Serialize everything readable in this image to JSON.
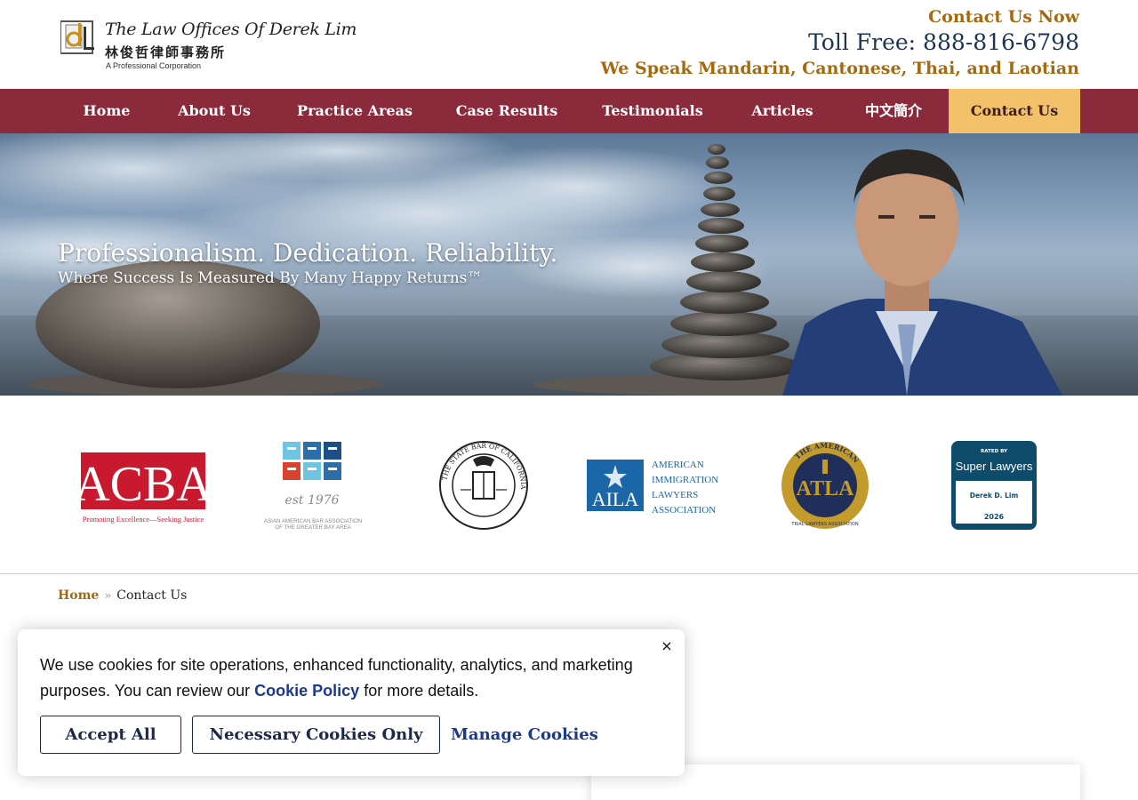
{
  "header": {
    "logo_name": "The Law Offices Of Derek Lim",
    "logo_cn": "林俊哲律師事務所",
    "logo_sub": "A Professional Corporation",
    "contact_now": "Contact Us Now",
    "toll_free": "Toll Free: 888-816-6798",
    "languages": "We Speak Mandarin, Cantonese, Thai, and Laotian"
  },
  "nav": {
    "items": [
      {
        "label": "Home"
      },
      {
        "label": "About Us"
      },
      {
        "label": "Practice Areas"
      },
      {
        "label": "Case Results"
      },
      {
        "label": "Testimonials"
      },
      {
        "label": "Articles"
      },
      {
        "label": "中文簡介"
      },
      {
        "label": "Contact Us",
        "active": true
      }
    ],
    "bg_color": "#8a2a3b",
    "active_color": "#f3c16a"
  },
  "hero": {
    "title": "Professionalism. Dedication. Reliability.",
    "subtitle": "Where Success Is Measured By Many Happy Returns™"
  },
  "badges": {
    "acba": {
      "title": "ACBA",
      "tagline": "Promoting Excellence—Seeking Justice"
    },
    "aaba": {
      "est": "est 1976",
      "name_line1": "ASIAN AMERICAN BAR ASSOCIATION",
      "name_line2": "OF THE GREATER BAY AREA"
    },
    "state_bar": {
      "ring_text": "THE STATE BAR OF CALIFORNIA"
    },
    "aila": {
      "abbr": "AILA",
      "line1": "AMERICAN",
      "line2": "IMMIGRATION",
      "line3": "LAWYERS",
      "line4": "ASSOCIATION"
    },
    "atla": {
      "abbr": "ATLA",
      "top": "THE AMERICAN",
      "bottom": "TRIAL LAWYERS ASSOCIATION"
    },
    "super_lawyers": {
      "rated": "RATED BY",
      "brand": "Super Lawyers",
      "name": "Derek D. Lim",
      "year": "2026"
    }
  },
  "breadcrumb": {
    "home": "Home",
    "separator": "»",
    "current": "Contact Us"
  },
  "cookie": {
    "text_before": "We use cookies for site operations, enhanced functionality, analytics, and marketing purposes. You can review our ",
    "link": "Cookie Policy",
    "text_after": " for more details.",
    "close": "×",
    "accept_all": "Accept All",
    "necessary_only": "Necessary Cookies Only",
    "manage": "Manage Cookies"
  },
  "colors": {
    "gold": "#a46a12",
    "navy": "#1d3550",
    "link_blue": "#1c3a8c"
  }
}
